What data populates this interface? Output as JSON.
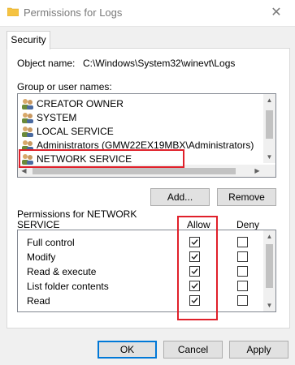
{
  "window": {
    "title": "Permissions for Logs",
    "close_glyph": "✕"
  },
  "tabs": [
    {
      "label": "Security"
    }
  ],
  "object": {
    "label": "Object name:",
    "value": "C:\\Windows\\System32\\winevt\\Logs"
  },
  "groups": {
    "label": "Group or user names:",
    "items": [
      {
        "label": "CREATOR OWNER"
      },
      {
        "label": "SYSTEM"
      },
      {
        "label": "LOCAL SERVICE"
      },
      {
        "label": "Administrators (GMW22EX19MBX\\Administrators)"
      },
      {
        "label": "NETWORK SERVICE",
        "selected": true
      }
    ],
    "add_button": "Add...",
    "remove_button": "Remove"
  },
  "permissions": {
    "label_line1": "Permissions for NETWORK",
    "label_line2": "SERVICE",
    "allow_header": "Allow",
    "deny_header": "Deny",
    "rows": [
      {
        "name": "Full control",
        "allow": true,
        "deny": false
      },
      {
        "name": "Modify",
        "allow": true,
        "deny": false
      },
      {
        "name": "Read & execute",
        "allow": true,
        "deny": false
      },
      {
        "name": "List folder contents",
        "allow": true,
        "deny": false
      },
      {
        "name": "Read",
        "allow": true,
        "deny": false
      }
    ]
  },
  "footer": {
    "ok": "OK",
    "cancel": "Cancel",
    "apply": "Apply"
  },
  "colors": {
    "highlight": "#e0202a",
    "accent": "#0078d7",
    "folder": "#f5c342"
  },
  "icons": [
    "folder-icon",
    "close-icon",
    "user-group-icon",
    "chevron-up-icon",
    "chevron-down-icon",
    "chevron-left-icon",
    "chevron-right-icon",
    "checkmark-icon"
  ]
}
